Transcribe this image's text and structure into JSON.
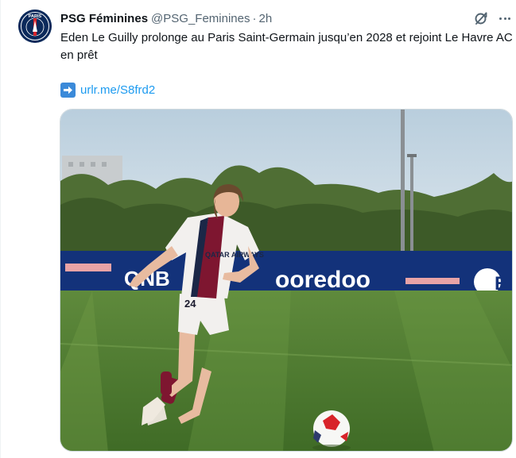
{
  "colors": {
    "text_primary": "#0f1419",
    "text_secondary": "#536471",
    "link": "#1d9bf0",
    "psg_navy": "#0b2a5b",
    "psg_red": "#d8232a"
  },
  "author": {
    "display_name": "PSG Féminines",
    "handle": "@PSG_Feminines",
    "separator": "·",
    "time": "2h",
    "avatar_icon": "psg-crest-icon",
    "avatar_text": "PARIS"
  },
  "actions": {
    "grok_icon": "grok-icon",
    "more_icon": "more-icon"
  },
  "tweet": {
    "text": "Eden Le Guilly prolonge au Paris Saint-Germain jusqu’en 2028 et rejoint Le Havre AC en prêt",
    "link_icon": "right-arrow-emoji-icon",
    "link_text": "urlr.me/S8frd2"
  },
  "media": {
    "banner_sponsor_left": "QNB",
    "banner_sponsor_main": "ooredoo",
    "banner_sponsor_right": "EA",
    "jersey_sponsor": "QATAR AIRWAYS",
    "shorts_number": "24"
  }
}
